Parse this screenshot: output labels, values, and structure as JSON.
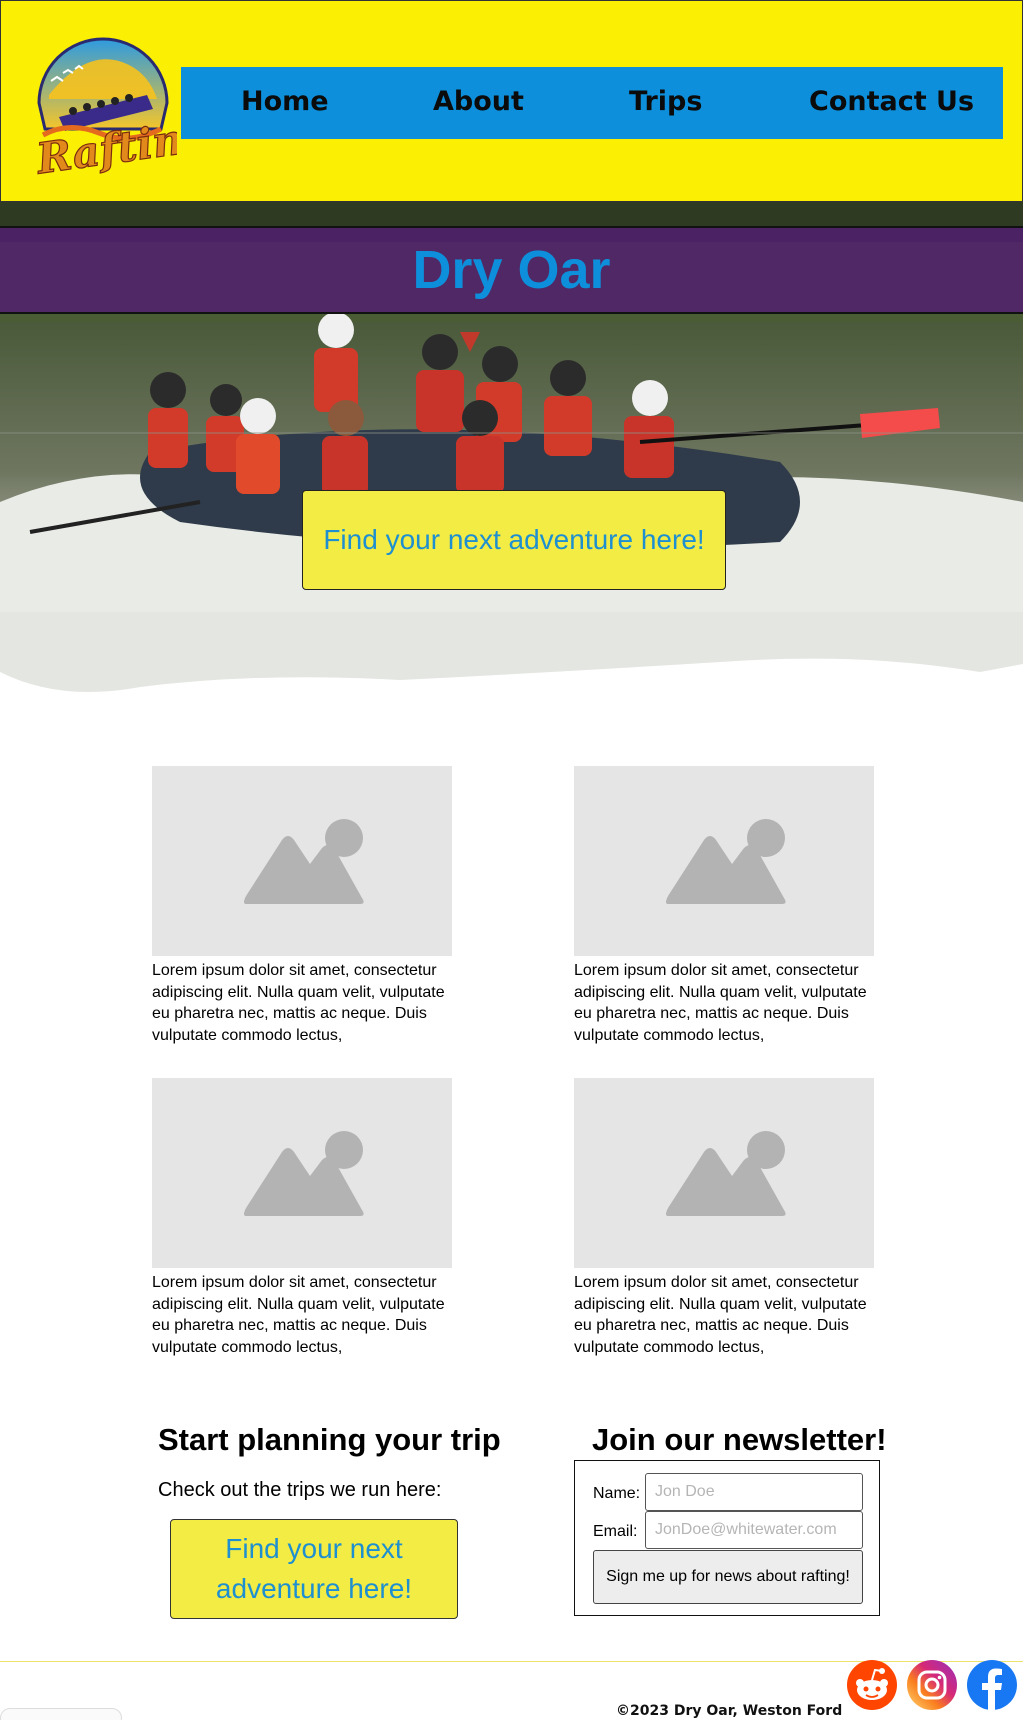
{
  "brand": {
    "logo_text": "Rafting"
  },
  "nav": {
    "items": [
      "Home",
      "About",
      "Trips",
      "Contact Us"
    ]
  },
  "hero": {
    "title": "Dry Oar",
    "cta_label": "Find your next adventure here!"
  },
  "cards": [
    {
      "text": "Lorem ipsum dolor sit amet, consectetur adipiscing elit. Nulla quam velit, vulputate eu pharetra nec, mattis ac neque. Duis vulputate commodo lectus,"
    },
    {
      "text": "Lorem ipsum dolor sit amet, consectetur adipiscing elit. Nulla quam velit, vulputate eu pharetra nec, mattis ac neque. Duis vulputate commodo lectus,"
    },
    {
      "text": "Lorem ipsum dolor sit amet, consectetur adipiscing elit. Nulla quam velit, vulputate eu pharetra nec, mattis ac neque. Duis vulputate commodo lectus,"
    },
    {
      "text": "Lorem ipsum dolor sit amet, consectetur adipiscing elit. Nulla quam velit, vulputate eu pharetra nec, mattis ac neque. Duis vulputate commodo lectus,"
    }
  ],
  "planning": {
    "title": "Start planning your trip",
    "subtitle": "Check out the trips we run here:",
    "button_label": "Find your next adventure here!"
  },
  "newsletter": {
    "title": "Join our newsletter!",
    "name_label": "Name:",
    "name_placeholder": "Jon Doe",
    "email_label": "Email:",
    "email_placeholder": "JonDoe@whitewater.com",
    "submit_label": "Sign me up for news about rafting!"
  },
  "footer": {
    "copyright": "©2023 Dry Oar, Weston Ford"
  },
  "social": {
    "icons": [
      "reddit-icon",
      "instagram-icon",
      "facebook-icon"
    ]
  },
  "colors": {
    "header_bg": "#FBF004",
    "nav_bg": "#0D8FDB",
    "title_band": "#501E6E",
    "title_text": "#0D8FDB",
    "cta_bg": "#F2EC45",
    "cta_text": "#1E8FD0",
    "reddit": "#FF4500",
    "facebook": "#1877F2"
  }
}
